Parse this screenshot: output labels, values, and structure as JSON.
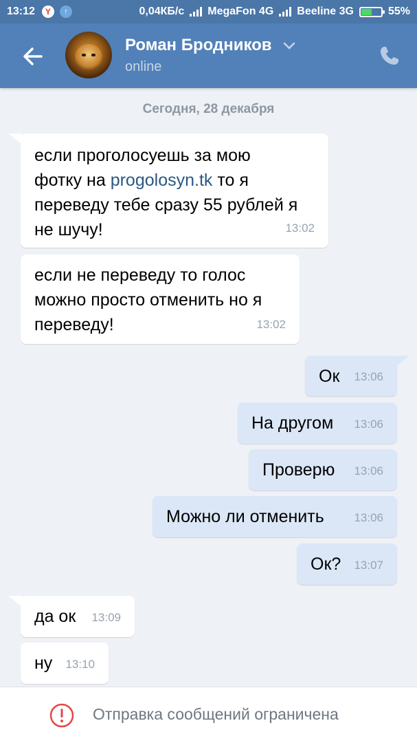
{
  "status_bar": {
    "time": "13:12",
    "speed": "0,04КБ/с",
    "carrier1": "MegaFon 4G",
    "carrier2": "Beeline 3G",
    "battery": "55%",
    "battery_level": 0.55
  },
  "header": {
    "contact_name": "Роман Бродников",
    "presence": "online"
  },
  "chat": {
    "date_separator": "Сегодня, 28 декабря",
    "messages": [
      {
        "direction": "in",
        "line1": "если проголосуешь за мою",
        "line2_prefix": "фотку на ",
        "line2_link": "progolosyn.tk",
        "line2_suffix": " то я",
        "line3": "переведу тебе сразу 55 рублей я",
        "line4": "не шучу!",
        "time": "13:02"
      },
      {
        "direction": "in",
        "line1": "если не переведу то голос",
        "line2": "можно просто отменить но я",
        "line3": "переведу!",
        "time": "13:02"
      },
      {
        "direction": "out",
        "text": "Ок",
        "time": "13:06"
      },
      {
        "direction": "out",
        "text": "На другом",
        "time": "13:06"
      },
      {
        "direction": "out",
        "text": "Проверю",
        "time": "13:06"
      },
      {
        "direction": "out",
        "text": "Можно ли отменить",
        "time": "13:06"
      },
      {
        "direction": "out",
        "text": "Ок?",
        "time": "13:07"
      },
      {
        "direction": "in",
        "text": "да ок",
        "time": "13:09"
      },
      {
        "direction": "in",
        "text": "ну",
        "time": "13:10"
      }
    ]
  },
  "bottom_bar": {
    "notice": "Отправка сообщений ограничена"
  },
  "colors": {
    "header_bg": "#5181b8",
    "status_bar_bg": "#4a76a8",
    "incoming_bubble": "#ffffff",
    "outgoing_bubble": "#dbe7f7",
    "chat_bg": "#eef1f5",
    "warning_red": "#e64646",
    "link": "#2a5885"
  }
}
